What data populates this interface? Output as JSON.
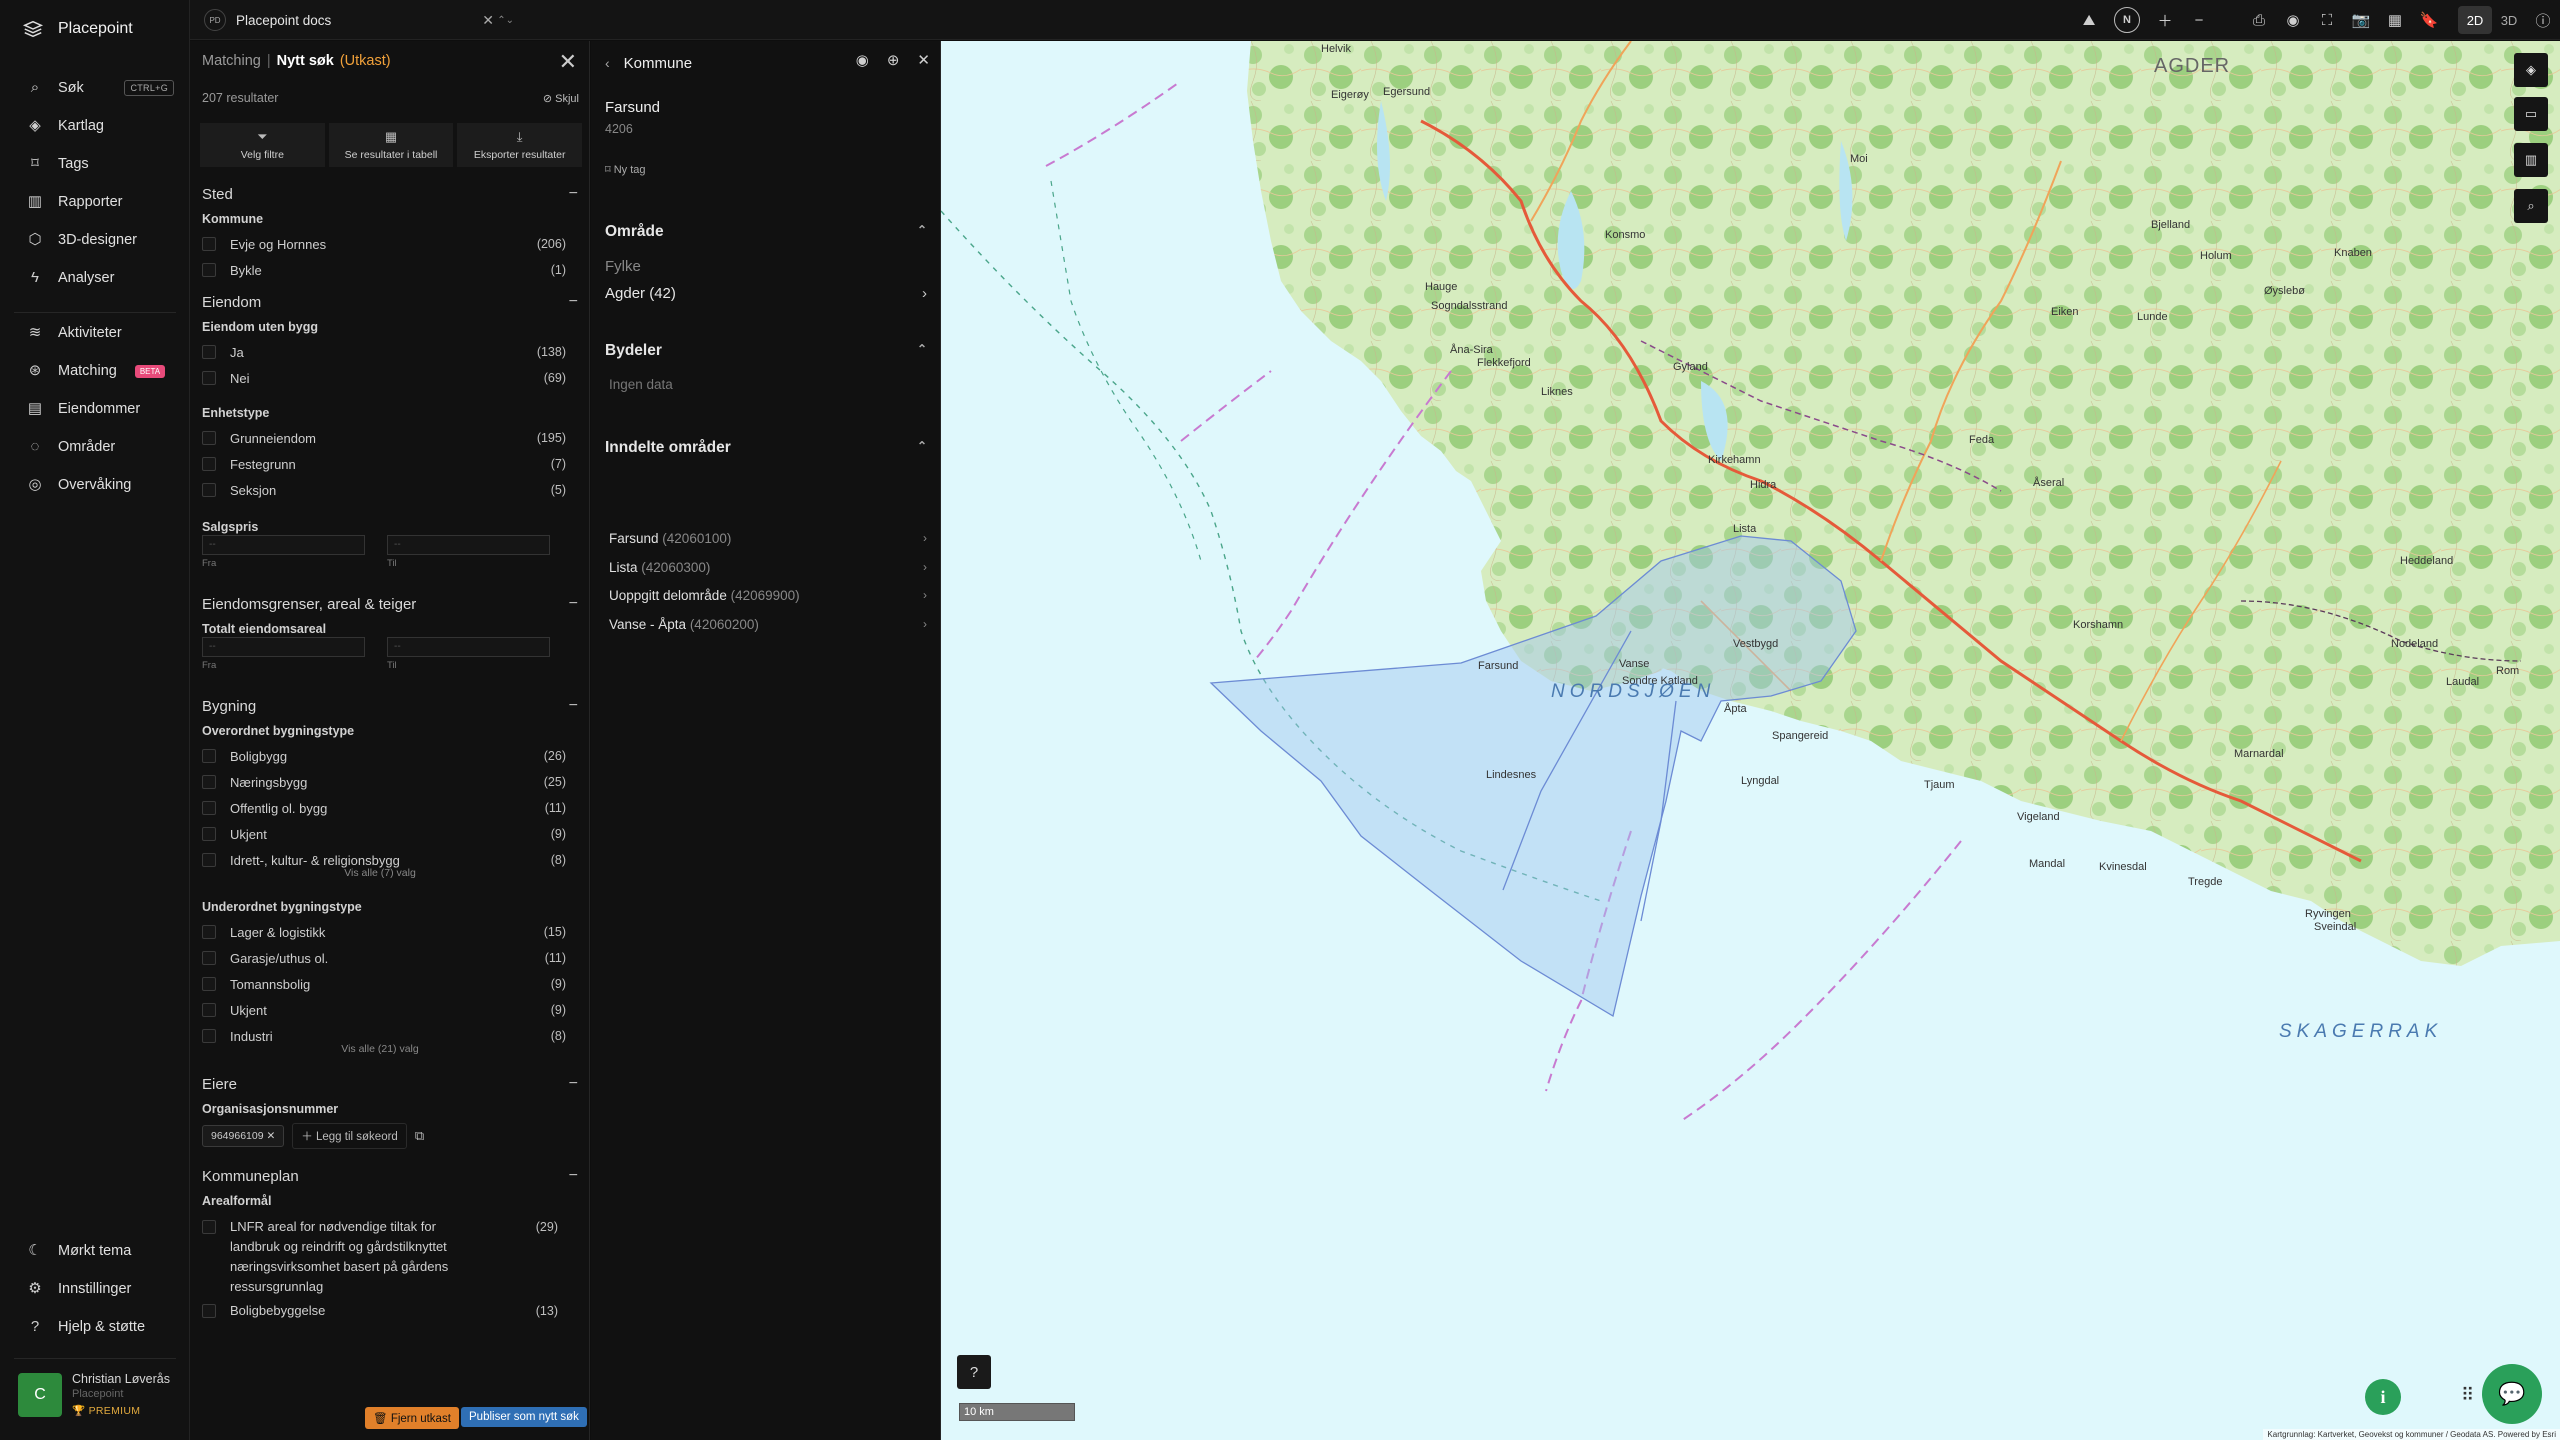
{
  "nav": {
    "brand": "Placepoint",
    "items_top": [
      {
        "label": "Søk",
        "icon": "search-icon",
        "kbd": "CTRL+G"
      },
      {
        "label": "Kartlag",
        "icon": "layers-icon"
      },
      {
        "label": "Tags",
        "icon": "bookmark-icon"
      },
      {
        "label": "Rapporter",
        "icon": "bar-chart-icon"
      },
      {
        "label": "3D-designer",
        "icon": "cube-icon"
      },
      {
        "label": "Analyser",
        "icon": "bolt-icon"
      }
    ],
    "items_mid": [
      {
        "label": "Aktiviteter",
        "icon": "activity-icon"
      },
      {
        "label": "Matching",
        "icon": "matching-icon",
        "badge": "BETA"
      },
      {
        "label": "Eiendommer",
        "icon": "building-icon"
      },
      {
        "label": "Områder",
        "icon": "area-icon"
      },
      {
        "label": "Overvåking",
        "icon": "monitor-icon"
      }
    ],
    "items_bottom": [
      {
        "label": "Mørkt tema",
        "icon": "moon-icon"
      },
      {
        "label": "Innstillinger",
        "icon": "gear-icon"
      },
      {
        "label": "Hjelp & støtte",
        "icon": "help-icon"
      }
    ],
    "user": {
      "initial": "C",
      "name": "Christian Løverås",
      "org": "Placepoint",
      "plan": "PREMIUM"
    }
  },
  "topbar": {
    "workspace_badge": "PD",
    "workspace": "Placepoint docs",
    "view_2d": "2D",
    "view_3d": "3D",
    "compass": "N"
  },
  "matching": {
    "crumb": "Matching",
    "sep": "|",
    "title": "Nytt søk",
    "draft": "(Utkast)",
    "count": "207 resultater",
    "hide": "Skjul",
    "actions": [
      {
        "label": "Velg filtre",
        "icon": "filter-icon"
      },
      {
        "label": "Se resultater i tabell",
        "icon": "table-icon"
      },
      {
        "label": "Eksporter resultater",
        "icon": "download-icon"
      }
    ],
    "sted": {
      "title": "Sted",
      "kommune_label": "Kommune",
      "options": [
        {
          "label": "Evje og Hornnes",
          "count": "(206)"
        },
        {
          "label": "Bykle",
          "count": "(1)"
        }
      ]
    },
    "eiendom": {
      "title": "Eiendom",
      "uten_bygg_label": "Eiendom uten bygg",
      "uten_bygg": [
        {
          "label": "Ja",
          "count": "(138)"
        },
        {
          "label": "Nei",
          "count": "(69)"
        }
      ],
      "enhetstype_label": "Enhetstype",
      "enhetstype": [
        {
          "label": "Grunneiendom",
          "count": "(195)"
        },
        {
          "label": "Festegrunn",
          "count": "(7)"
        },
        {
          "label": "Seksjon",
          "count": "(5)"
        }
      ],
      "salgspris_label": "Salgspris",
      "from": "Fra",
      "to": "Til",
      "range_placeholder": "--"
    },
    "grenser": {
      "title": "Eiendomsgrenser, areal & teiger",
      "areal_label": "Totalt eiendomsareal",
      "from": "Fra",
      "to": "Til"
    },
    "bygning": {
      "title": "Bygning",
      "over_label": "Overordnet bygningstype",
      "over": [
        {
          "label": "Boligbygg",
          "count": "(26)"
        },
        {
          "label": "Næringsbygg",
          "count": "(25)"
        },
        {
          "label": "Offentlig ol. bygg",
          "count": "(11)"
        },
        {
          "label": "Ukjent",
          "count": "(9)"
        },
        {
          "label": "Idrett-, kultur- & religionsbygg",
          "count": "(8)"
        }
      ],
      "over_more": "Vis alle (7) valg",
      "under_label": "Underordnet bygningstype",
      "under": [
        {
          "label": "Lager & logistikk",
          "count": "(15)"
        },
        {
          "label": "Garasje/uthus ol.",
          "count": "(11)"
        },
        {
          "label": "Tomannsbolig",
          "count": "(9)"
        },
        {
          "label": "Ukjent",
          "count": "(9)"
        },
        {
          "label": "Industri",
          "count": "(8)"
        }
      ],
      "under_more": "Vis alle (21) valg"
    },
    "eiere": {
      "title": "Eiere",
      "org_label": "Organisasjonsnummer",
      "chip": "964966109",
      "add": "Legg til søkeord"
    },
    "kommuneplan": {
      "title": "Kommuneplan",
      "areal_label": "Arealformål",
      "long_option": "LNFR areal for nødvendige tiltak for landbruk og reindrift og gårdstilknyttet næringsvirksomhet basert på gårdens ressursgrunnlag",
      "long_count": "(29)",
      "partial": "Boligbebyggelse",
      "partial_count": "(13)"
    },
    "btn_remove": "Fjern utkast",
    "btn_publish": "Publiser som nytt søk"
  },
  "kommune": {
    "header": "Kommune",
    "name": "Farsund",
    "number": "4206",
    "tag": "Ny tag",
    "omrade_title": "Område",
    "fylke_label": "Fylke",
    "fylke_value": "Agder (42)",
    "bydeler_title": "Bydeler",
    "no_data": "Ingen data",
    "inndelte_title": "Inndelte områder",
    "areas": [
      {
        "name": "Farsund",
        "code": "(42060100)"
      },
      {
        "name": "Lista",
        "code": "(42060300)"
      },
      {
        "name": "Uoppgitt delområde",
        "code": "(42069900)"
      },
      {
        "name": "Vanse - Åpta",
        "code": "(42060200)"
      }
    ]
  },
  "map": {
    "scale": "10 km",
    "attribution": "Kartgrunnlag: Kartverket, Geovekst og kommuner / Geodata AS. Powered by Esri",
    "sea_labels": [
      "NORDSJØEN",
      "SKAGERRAK"
    ],
    "region_label": "AGDER",
    "place_labels": [
      "Helvik",
      "Eigerøy",
      "Egersund",
      "Moi",
      "Hauge",
      "Sogndalsstrand",
      "Åna-Sira",
      "Flekkefjord",
      "Feda",
      "Kirkehamn",
      "Hidra",
      "Lista",
      "Vestbygd",
      "Vanse",
      "Farsund",
      "Åpta",
      "Sondre Katland",
      "Spangereid",
      "Lindesnes",
      "Lyngdal",
      "Vigeland",
      "Mandal",
      "Kvinesdal",
      "Liknes",
      "Gyland",
      "Lunde",
      "Konsmo",
      "Åseral",
      "Eiken",
      "Bjelland",
      "Holum",
      "Marnardal",
      "Tregde",
      "Ryvingen",
      "Sveindal",
      "Knaben",
      "Øyslebø",
      "Laudal",
      "Heddeland",
      "Nodeland",
      "Rom",
      "Korshamn",
      "Tjaum"
    ],
    "colors": {
      "sea": "#dff8fc",
      "land": "#dcefc6",
      "forest": "#a6d48a",
      "road": "#e55a3a",
      "selection": "#9fc6f0"
    }
  }
}
